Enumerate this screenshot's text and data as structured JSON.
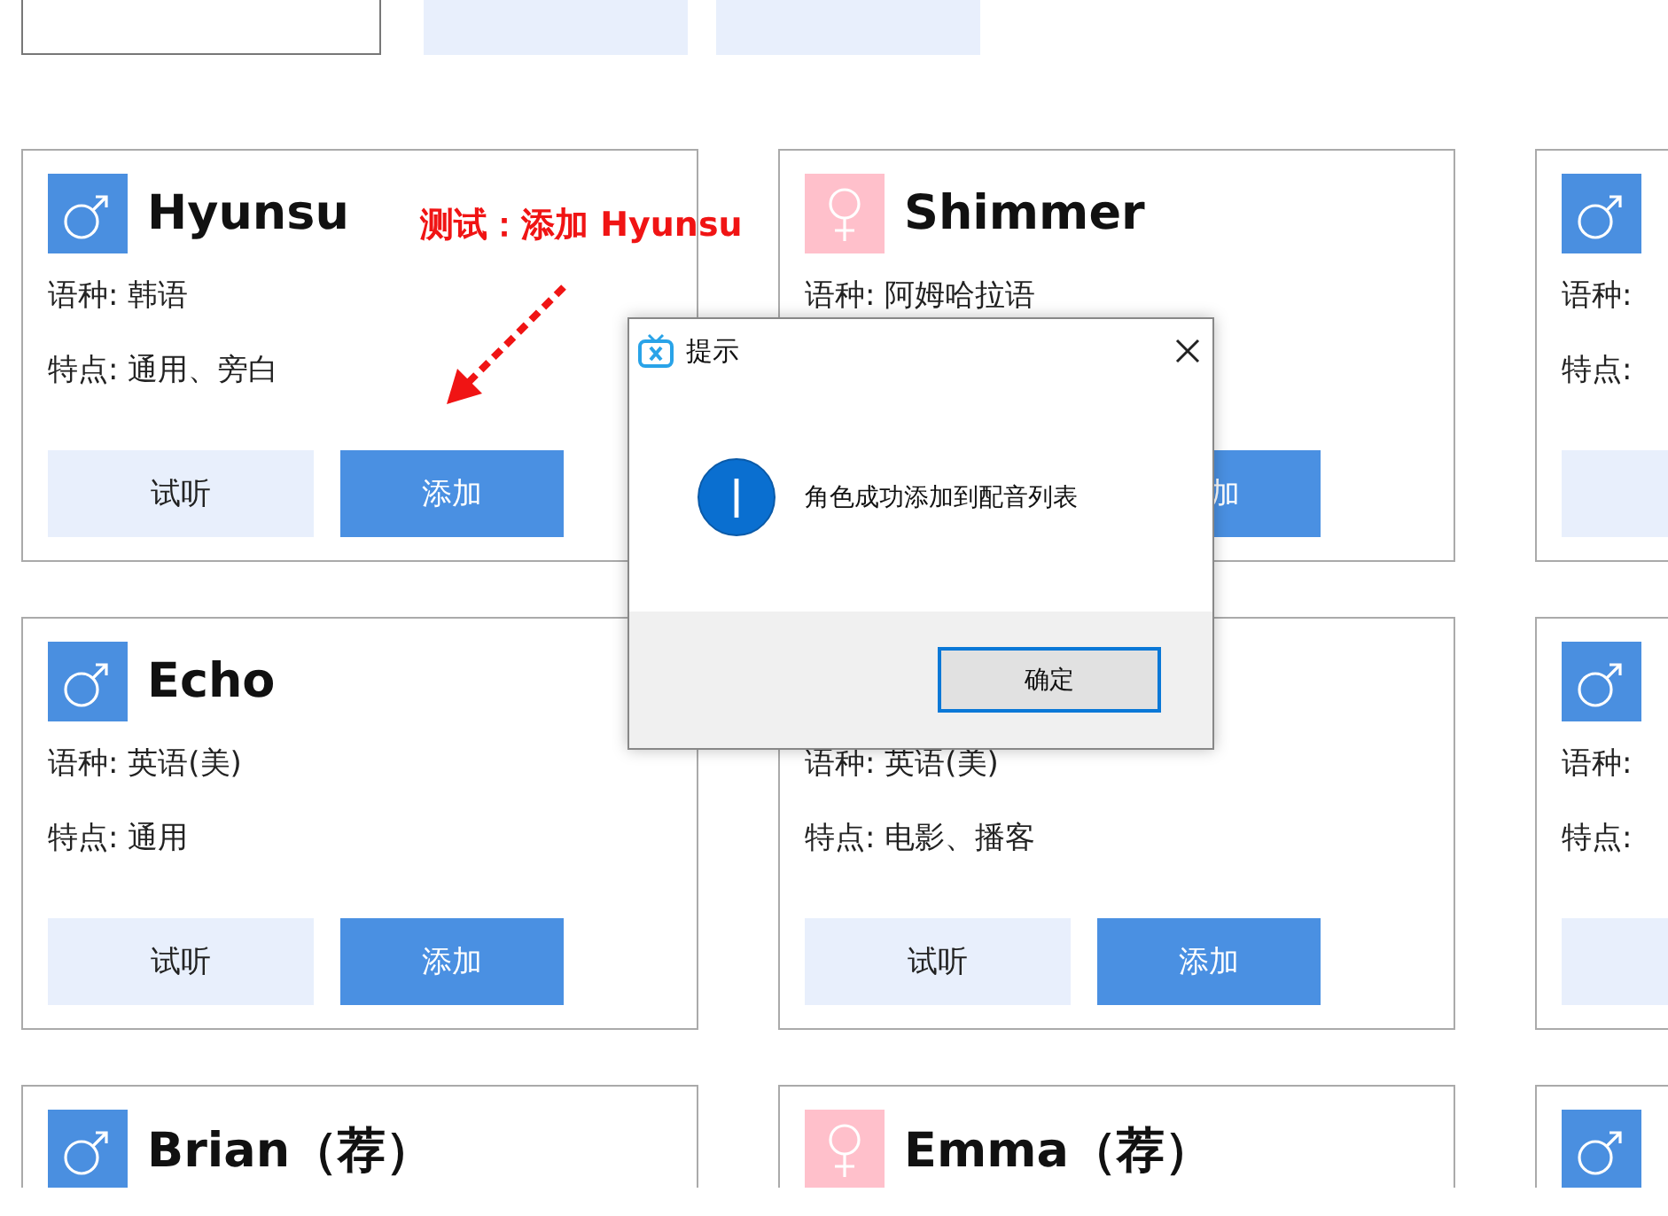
{
  "cards": [
    {
      "kind": "male",
      "name": "Hyunsu",
      "language": "语种: 韩语",
      "features": "特点: 通用、旁白",
      "buttons": [
        {
          "kind": "listen",
          "label": "试听"
        },
        {
          "kind": "add",
          "label": "添加"
        }
      ]
    },
    {
      "kind": "female",
      "name": "Shimmer",
      "language": "语种: 阿姆哈拉语",
      "buttons": [
        {
          "kind": "add",
          "label": "加"
        }
      ]
    },
    {
      "kind": "male",
      "language": "语种:",
      "features": "特点:",
      "buttons": [
        {
          "kind": "listen"
        }
      ]
    },
    {
      "kind": "male",
      "name": "Echo",
      "language": "语种: 英语(美)",
      "features": "特点: 通用",
      "buttons": [
        {
          "kind": "listen",
          "label": "试听"
        },
        {
          "kind": "add",
          "label": "添加"
        }
      ]
    },
    {
      "language": "语种: 英语(美)",
      "features": "特点: 电影、播客",
      "buttons": [
        {
          "kind": "listen",
          "label": "试听"
        },
        {
          "kind": "add",
          "label": "添加"
        }
      ]
    },
    {
      "kind": "male",
      "language": "语种:",
      "features": "特点:",
      "buttons": [
        {
          "kind": "listen"
        }
      ]
    },
    {
      "kind": "male",
      "name": "Brian（荐）"
    },
    {
      "kind": "female",
      "name": "Emma（荐）"
    },
    {
      "kind": "male"
    }
  ],
  "annotation": {
    "text": "测试：添加 Hyunsu"
  },
  "dialog": {
    "title": "提示",
    "message": "角色成功添加到配音列表",
    "ok_button": "确定"
  }
}
